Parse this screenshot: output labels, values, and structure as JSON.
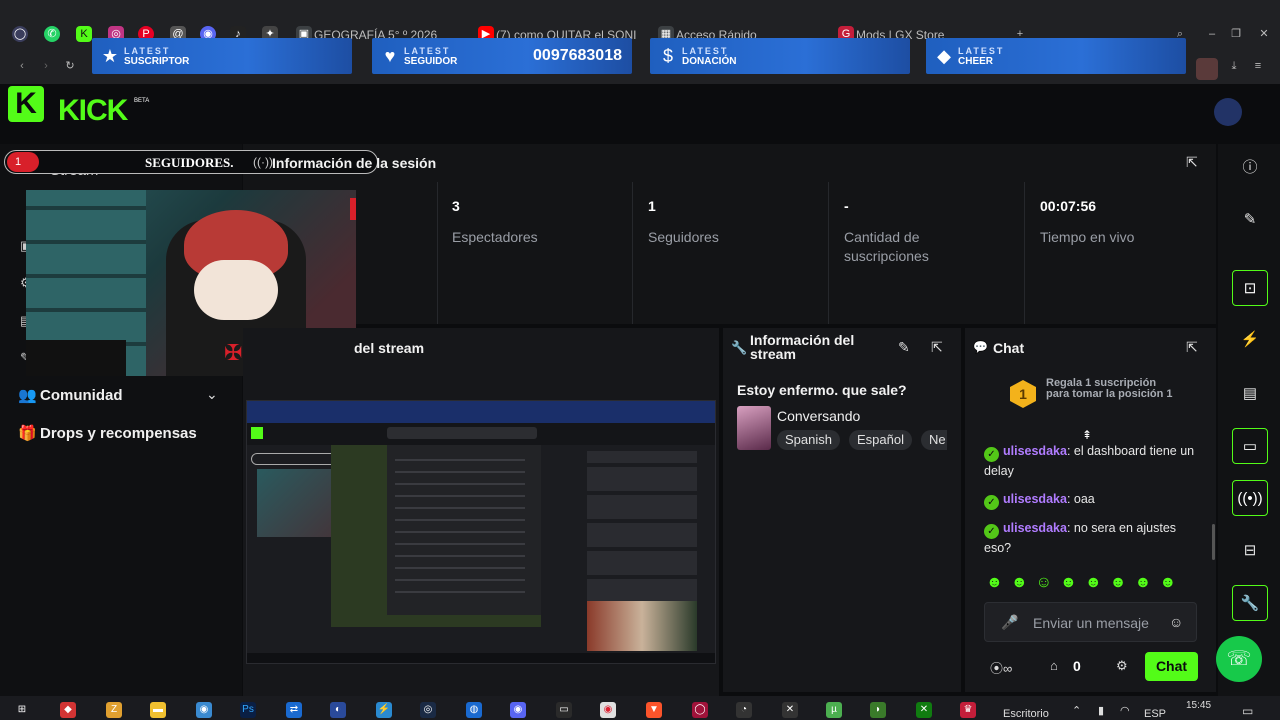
{
  "browser": {
    "tabs": [
      {
        "label": "GEOGRAFÍA 5° º 2026"
      },
      {
        "label": "(7) como QUITAR el SONI"
      },
      {
        "label": "Acceso Rápido"
      },
      {
        "label": "Mods | GX Store"
      }
    ]
  },
  "overlay": {
    "banners": [
      {
        "small": "LATEST",
        "label": "SUSCRIPTOR",
        "value": ""
      },
      {
        "small": "LATEST",
        "label": "SEGUIDOR",
        "value": "0097683018"
      },
      {
        "small": "LATEST",
        "label": "DONACIÓN",
        "value": ""
      },
      {
        "small": "LATEST",
        "label": "CHEER",
        "value": ""
      }
    ],
    "followers_alert": {
      "count": "1",
      "label": "SEGUIDORES."
    }
  },
  "kick": {
    "logo_text": "KICK",
    "beta": "BETA"
  },
  "sidebar": {
    "stream_label": "Stream",
    "items": [
      {
        "label": "Comunidad"
      },
      {
        "label": "Drops y recompensas"
      }
    ]
  },
  "session": {
    "title": "Información de la sesión",
    "stats": [
      {
        "value": "3",
        "label": "Espectadores"
      },
      {
        "value": "1",
        "label": "Seguidores"
      },
      {
        "value": "-",
        "label": "Cantidad de suscripciones"
      },
      {
        "value": "00:07:56",
        "label": "Tiempo en vivo"
      }
    ]
  },
  "preview": {
    "title": "del stream"
  },
  "stream_info": {
    "title": "Información del stream",
    "stream_title": "Estoy enfermo. que sale?",
    "category": "Conversando",
    "tags": [
      "Spanish",
      "Español",
      "Ne"
    ]
  },
  "chat": {
    "title": "Chat",
    "sub_gift": {
      "rank": "1",
      "text": "Regala 1 suscripción para tomar la posición 1"
    },
    "messages": [
      {
        "user": "ulisesdaka",
        "text": ": el dashboard tiene un delay"
      },
      {
        "user": "ulisesdaka",
        "text": ": oaa"
      },
      {
        "user": "ulisesdaka",
        "text": ": no sera en ajustes eso?"
      }
    ],
    "input_placeholder": "Enviar un mensaje",
    "points": "0",
    "send_label": "Chat"
  },
  "taskbar": {
    "desktop_label": "Escritorio",
    "lang": "ESP",
    "time": "15:45"
  },
  "colors": {
    "kick_green": "#53fc18",
    "banner_blue": "#2b6fd6",
    "panel_bg": "#16171a"
  }
}
